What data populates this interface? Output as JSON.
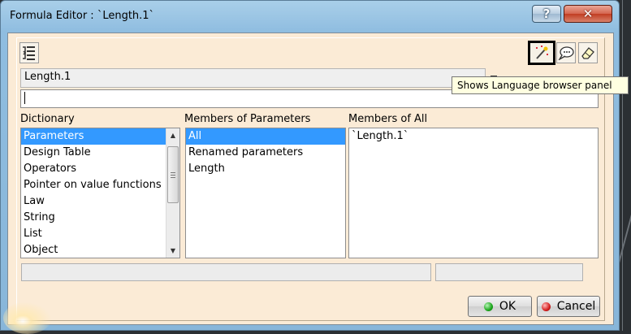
{
  "window": {
    "title": "Formula Editor : `Length.1`",
    "help_label": "?",
    "close_label": "✕"
  },
  "toolbar": {
    "tooltip": "Shows Language browser panel"
  },
  "formula": {
    "name": "Length.1",
    "value": ""
  },
  "columns": {
    "dictionary": {
      "label": "Dictionary",
      "items": [
        "Parameters",
        "Design Table",
        "Operators",
        "Pointer on value functions",
        "Law",
        "String",
        "List",
        "Object"
      ],
      "selected": 0
    },
    "members_params": {
      "label": "Members of Parameters",
      "items": [
        "All",
        "Renamed parameters",
        "Length"
      ],
      "selected": 0
    },
    "members_all": {
      "label": "Members of All",
      "items": [
        "`Length.1`"
      ]
    }
  },
  "buttons": {
    "ok": "OK",
    "cancel": "Cancel"
  },
  "colors": {
    "selection": "#3399ff",
    "client_bg": "#fbebd6",
    "frame": "#8fbde0"
  }
}
